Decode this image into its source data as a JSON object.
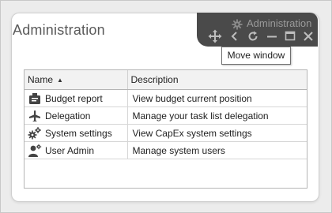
{
  "panel": {
    "title": "Administration"
  },
  "toolbar": {
    "title": "Administration",
    "buttons": [
      "move-icon",
      "back-icon",
      "refresh-icon",
      "minimize-icon",
      "maximize-icon",
      "close-icon"
    ]
  },
  "tooltip": {
    "text": "Move window"
  },
  "grid": {
    "columns": [
      {
        "label": "Name",
        "sort": "ascending"
      },
      {
        "label": "Description"
      }
    ],
    "rows": [
      {
        "icon": "budget-report-icon",
        "name": "Budget report",
        "description": "View budget current position"
      },
      {
        "icon": "delegation-icon",
        "name": "Delegation",
        "description": "Manage your task list delegation"
      },
      {
        "icon": "system-settings-icon",
        "name": "System settings",
        "description": "View CapEx system settings"
      },
      {
        "icon": "user-admin-icon",
        "name": "User Admin",
        "description": "Manage system users"
      }
    ]
  },
  "colors": {
    "toolbar": "#4a4a4a",
    "panel_background": "#ffffff",
    "page_background": "#ececec"
  }
}
